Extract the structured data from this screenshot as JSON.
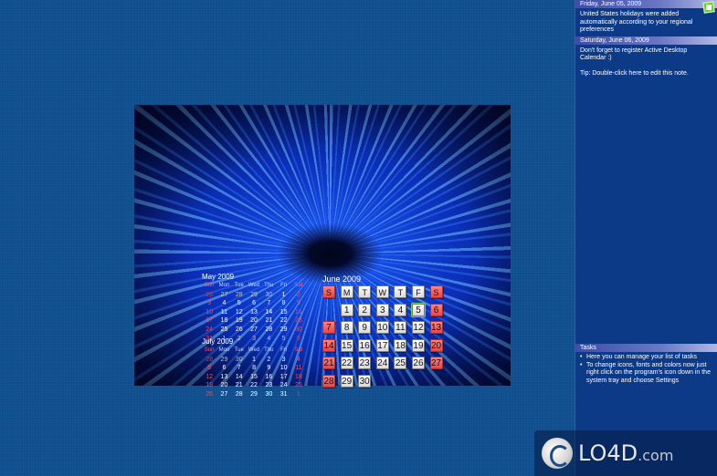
{
  "may": {
    "title": "May 2009",
    "weekdays": [
      "Sun",
      "Mon",
      "Tue",
      "Wed",
      "Thu",
      "Fri",
      "Sat"
    ],
    "weeks": [
      [
        "26",
        "27",
        "28",
        "29",
        "30",
        "1",
        "2"
      ],
      [
        "3",
        "4",
        "5",
        "6",
        "7",
        "8",
        "9"
      ],
      [
        "10",
        "11",
        "12",
        "13",
        "14",
        "15",
        "16"
      ],
      [
        "17",
        "18",
        "19",
        "20",
        "21",
        "22",
        "23"
      ],
      [
        "24",
        "25",
        "26",
        "27",
        "28",
        "29",
        "30"
      ],
      [
        "31",
        "1",
        "2",
        "3",
        "4",
        "5",
        "6"
      ]
    ]
  },
  "july": {
    "title": "July 2009",
    "weekdays": [
      "Sun",
      "Mon",
      "Tue",
      "Wed",
      "Thu",
      "Fri",
      "Sat"
    ],
    "weeks": [
      [
        "28",
        "29",
        "30",
        "1",
        "2",
        "3",
        "4"
      ],
      [
        "5",
        "6",
        "7",
        "8",
        "9",
        "10",
        "11"
      ],
      [
        "12",
        "13",
        "14",
        "15",
        "16",
        "17",
        "18"
      ],
      [
        "19",
        "20",
        "21",
        "22",
        "23",
        "24",
        "25"
      ],
      [
        "26",
        "27",
        "28",
        "29",
        "30",
        "31",
        "1"
      ]
    ]
  },
  "june": {
    "title": "June 2009",
    "weekdays": [
      "S",
      "M",
      "T",
      "W",
      "T",
      "F",
      "S"
    ],
    "weeks": [
      [
        "",
        "1",
        "2",
        "3",
        "4",
        "5",
        "6"
      ],
      [
        "7",
        "8",
        "9",
        "10",
        "11",
        "12",
        "13"
      ],
      [
        "14",
        "15",
        "16",
        "17",
        "18",
        "19",
        "20"
      ],
      [
        "21",
        "22",
        "23",
        "24",
        "25",
        "26",
        "27"
      ],
      [
        "28",
        "29",
        "30",
        "",
        "",
        "",
        ""
      ]
    ],
    "today": "5"
  },
  "notes": {
    "note1": {
      "date": "Friday, June 05, 2009",
      "text": "United States holidays were added automatically according to your regional preferences"
    },
    "note2": {
      "date": "Saturday, June 06, 2009",
      "text": "Don't forget to register Active Desktop Calendar :)"
    },
    "tip": "Tip: Double-click here to edit this note.",
    "tasks": {
      "title": "Tasks",
      "items": [
        "Here you can manage your list of tasks",
        "To change icons, fonts and colors now just right click on the program's icon down in the system tray and choose Settings"
      ]
    }
  },
  "watermark": {
    "text": "LO4D",
    "suffix": ".com"
  },
  "colors": {
    "desktop": "#0f4f8f",
    "weekend": "#e84747",
    "panel": "#0d3a86"
  }
}
